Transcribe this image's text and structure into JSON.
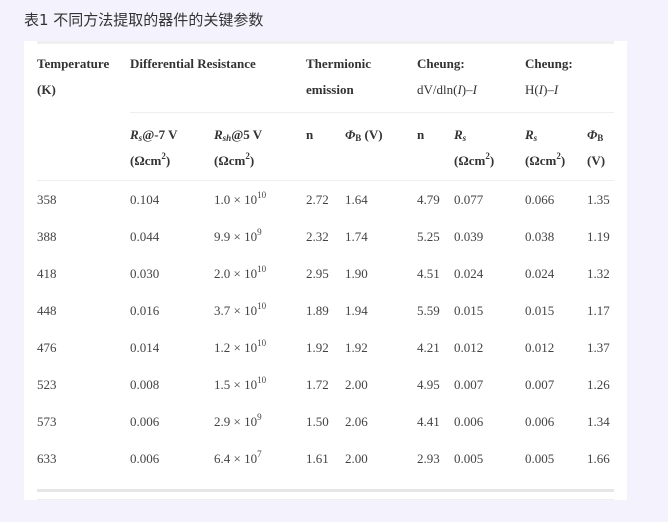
{
  "caption": "表1 不同方法提取的器件的关键参数",
  "table": {
    "group_headers": {
      "temperature_line1": "Temperature",
      "temperature_line2": "(K)",
      "differential_resistance": "Differential Resistance",
      "thermionic_line1": "Thermionic",
      "thermionic_line2": "emission",
      "cheung1_line1": "Cheung:",
      "cheung1_line2": "dV/dln(I)–I",
      "cheung2_line1": "Cheung:",
      "cheung2_line2": "H(I)–I"
    },
    "sub_headers": {
      "rs_label": "R",
      "rs_sub": "s",
      "rs_cond": "@-7 V",
      "rs_unit": "(Ωcm",
      "unit_sup": "2",
      "unit_close": ")",
      "rsh_label": "R",
      "rsh_sub": "sh",
      "rsh_cond": "@5 V",
      "n_label": "n",
      "phib_label": "Φ",
      "phib_sub": "B",
      "phib_unit": " (V)",
      "phib_unit_alone": "(V)"
    },
    "rows": [
      {
        "T": "358",
        "Rs": "0.104",
        "Rsh_mant": "1.0 × 10",
        "Rsh_exp": "10",
        "n_te": "2.72",
        "phi_te": "1.64",
        "n_ch": "4.79",
        "rs_ch1": "0.077",
        "rs_ch2": "0.066",
        "phi_ch": "1.35"
      },
      {
        "T": "388",
        "Rs": "0.044",
        "Rsh_mant": "9.9 × 10",
        "Rsh_exp": "9",
        "n_te": "2.32",
        "phi_te": "1.74",
        "n_ch": "5.25",
        "rs_ch1": "0.039",
        "rs_ch2": "0.038",
        "phi_ch": "1.19"
      },
      {
        "T": "418",
        "Rs": "0.030",
        "Rsh_mant": "2.0 × 10",
        "Rsh_exp": "10",
        "n_te": "2.95",
        "phi_te": "1.90",
        "n_ch": "4.51",
        "rs_ch1": "0.024",
        "rs_ch2": "0.024",
        "phi_ch": "1.32"
      },
      {
        "T": "448",
        "Rs": "0.016",
        "Rsh_mant": "3.7 × 10",
        "Rsh_exp": "10",
        "n_te": "1.89",
        "phi_te": "1.94",
        "n_ch": "5.59",
        "rs_ch1": "0.015",
        "rs_ch2": "0.015",
        "phi_ch": "1.17"
      },
      {
        "T": "476",
        "Rs": "0.014",
        "Rsh_mant": "1.2 × 10",
        "Rsh_exp": "10",
        "n_te": "1.92",
        "phi_te": "1.92",
        "n_ch": "4.21",
        "rs_ch1": "0.012",
        "rs_ch2": "0.012",
        "phi_ch": "1.37"
      },
      {
        "T": "523",
        "Rs": "0.008",
        "Rsh_mant": "1.5 × 10",
        "Rsh_exp": "10",
        "n_te": "1.72",
        "phi_te": "2.00",
        "n_ch": "4.95",
        "rs_ch1": "0.007",
        "rs_ch2": "0.007",
        "phi_ch": "1.26"
      },
      {
        "T": "573",
        "Rs": "0.006",
        "Rsh_mant": "2.9 × 10",
        "Rsh_exp": "9",
        "n_te": "1.50",
        "phi_te": "2.06",
        "n_ch": "4.41",
        "rs_ch1": "0.006",
        "rs_ch2": "0.006",
        "phi_ch": "1.34"
      },
      {
        "T": "633",
        "Rs": "0.006",
        "Rsh_mant": "6.4 × 10",
        "Rsh_exp": "7",
        "n_te": "1.61",
        "phi_te": "2.00",
        "n_ch": "2.93",
        "rs_ch1": "0.005",
        "rs_ch2": "0.005",
        "phi_ch": "1.66"
      }
    ]
  }
}
